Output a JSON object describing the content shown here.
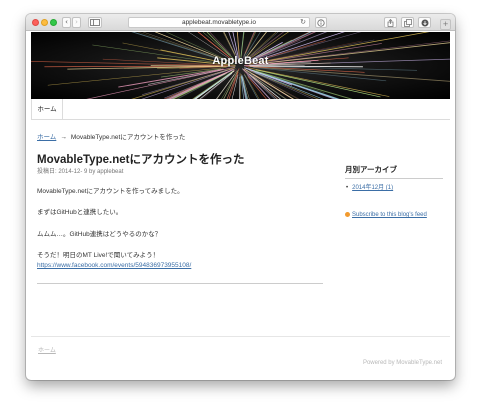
{
  "browser": {
    "url": "applebeat.movabletype.io",
    "back_glyph": "‹",
    "forward_glyph": "›",
    "reload_glyph": "↻",
    "plus_glyph": "+"
  },
  "site": {
    "title": "AppleBeat"
  },
  "nav": {
    "home_label": "ホーム"
  },
  "breadcrumb": {
    "home_label": "ホーム",
    "separator": "→",
    "current": "MovableType.netにアカウントを作った"
  },
  "post": {
    "title": "MovableType.netにアカウントを作った",
    "meta": "投稿日: 2014-12- 9 by applebeat",
    "paragraphs": {
      "p1": "MovableType.netにアカウントを作ってみました。",
      "p2": "まずはGitHubと連携したい。",
      "p3": "ムムム…。GitHub連携はどうやるのかな？",
      "p4": "そうだ！明日のMT Live!で聞いてみよう！",
      "link": "https://www.facebook.com/events/594836973955108/"
    }
  },
  "sidebar": {
    "archive_title": "月別アーカイブ",
    "archive_bullet": "•",
    "archive_item": "2014年12月 (1)",
    "feed_label": "Subscribe to this blog's feed"
  },
  "footer": {
    "home_label": "ホーム",
    "powered_by": "Powered by MovableType.net"
  },
  "colors": {
    "link": "#3b6ea6",
    "feed_icon": "#f29a2e",
    "banner_bg": "#000000"
  }
}
